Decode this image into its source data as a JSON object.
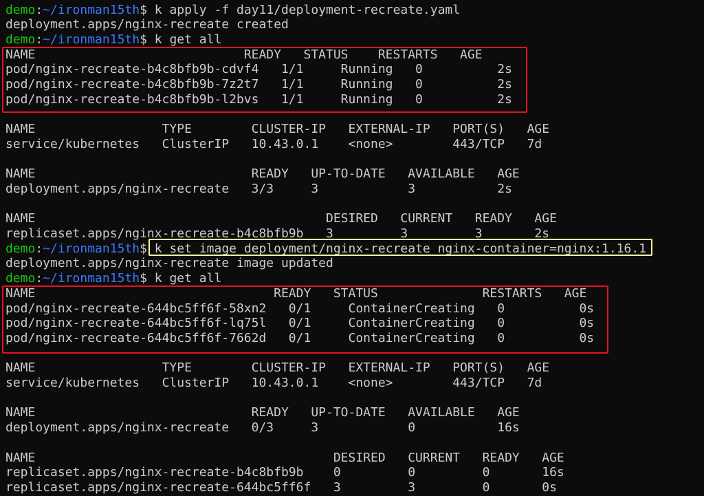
{
  "prompt": {
    "user": "demo",
    "path": "~/ironman15th",
    "symbol": "$ "
  },
  "lines": [
    {
      "type": "cmd",
      "text": "k apply -f day11/deployment-recreate.yaml"
    },
    {
      "type": "out",
      "text": "deployment.apps/nginx-recreate created"
    },
    {
      "type": "cmd",
      "text": "k get all"
    },
    {
      "type": "out",
      "text": "NAME                            READY   STATUS    RESTARTS   AGE"
    },
    {
      "type": "out",
      "text": "pod/nginx-recreate-b4c8bfb9b-cdvf4   1/1     Running   0          2s"
    },
    {
      "type": "out",
      "text": "pod/nginx-recreate-b4c8bfb9b-7z2t7   1/1     Running   0          2s"
    },
    {
      "type": "out",
      "text": "pod/nginx-recreate-b4c8bfb9b-l2bvs   1/1     Running   0          2s"
    },
    {
      "type": "out",
      "text": ""
    },
    {
      "type": "out",
      "text": "NAME                 TYPE        CLUSTER-IP   EXTERNAL-IP   PORT(S)   AGE"
    },
    {
      "type": "out",
      "text": "service/kubernetes   ClusterIP   10.43.0.1    <none>        443/TCP   7d"
    },
    {
      "type": "out",
      "text": ""
    },
    {
      "type": "out",
      "text": "NAME                             READY   UP-TO-DATE   AVAILABLE   AGE"
    },
    {
      "type": "out",
      "text": "deployment.apps/nginx-recreate   3/3     3            3           2s"
    },
    {
      "type": "out",
      "text": ""
    },
    {
      "type": "out",
      "text": "NAME                                       DESIRED   CURRENT   READY   AGE"
    },
    {
      "type": "out",
      "text": "replicaset.apps/nginx-recreate-b4c8bfb9b   3         3         3       2s"
    },
    {
      "type": "cmd",
      "text": "k set image deployment/nginx-recreate nginx-container=nginx:1.16.1"
    },
    {
      "type": "out",
      "text": "deployment.apps/nginx-recreate image updated"
    },
    {
      "type": "cmd",
      "text": "k get all"
    },
    {
      "type": "out",
      "text": "NAME                                READY   STATUS              RESTARTS   AGE"
    },
    {
      "type": "out",
      "text": "pod/nginx-recreate-644bc5ff6f-58xn2   0/1     ContainerCreating   0          0s"
    },
    {
      "type": "out",
      "text": "pod/nginx-recreate-644bc5ff6f-lq75l   0/1     ContainerCreating   0          0s"
    },
    {
      "type": "out",
      "text": "pod/nginx-recreate-644bc5ff6f-7662d   0/1     ContainerCreating   0          0s"
    },
    {
      "type": "out",
      "text": ""
    },
    {
      "type": "out",
      "text": "NAME                 TYPE        CLUSTER-IP   EXTERNAL-IP   PORT(S)   AGE"
    },
    {
      "type": "out",
      "text": "service/kubernetes   ClusterIP   10.43.0.1    <none>        443/TCP   7d"
    },
    {
      "type": "out",
      "text": ""
    },
    {
      "type": "out",
      "text": "NAME                             READY   UP-TO-DATE   AVAILABLE   AGE"
    },
    {
      "type": "out",
      "text": "deployment.apps/nginx-recreate   0/3     3            0           16s"
    },
    {
      "type": "out",
      "text": ""
    },
    {
      "type": "out",
      "text": "NAME                                        DESIRED   CURRENT   READY   AGE"
    },
    {
      "type": "out",
      "text": "replicaset.apps/nginx-recreate-b4c8bfb9b    0         0         0       16s"
    },
    {
      "type": "out",
      "text": "replicaset.apps/nginx-recreate-644bc5ff6f   3         3         0       0s"
    }
  ],
  "colors": {
    "background": "#0c0c0c",
    "text": "#cccccc",
    "prompt_user": "#16c60c",
    "prompt_path": "#3b78ff",
    "highlight_red": "#e81123",
    "highlight_yellow": "#f9f1a5"
  }
}
